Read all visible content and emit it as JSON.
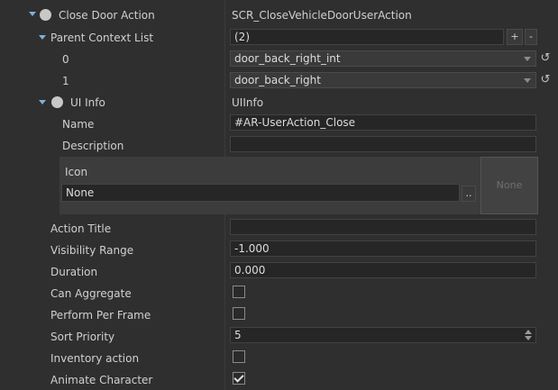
{
  "close_door_action": {
    "label": "Close Door Action",
    "value": "SCR_CloseVehicleDoorUserAction"
  },
  "parent_context_list": {
    "label": "Parent Context List",
    "count": "(2)",
    "add_label": "+",
    "remove_label": "-",
    "items": [
      {
        "index": "0",
        "value": "door_back_right_int"
      },
      {
        "index": "1",
        "value": "door_back_right"
      }
    ]
  },
  "ui_info": {
    "label": "UI Info",
    "value": "UIInfo",
    "name_label": "Name",
    "name_value": "#AR-UserAction_Close",
    "description_label": "Description",
    "description_value": "",
    "icon_label": "Icon",
    "icon_value": "None",
    "icon_browse": "..",
    "icon_preview": "None"
  },
  "properties": {
    "action_title_label": "Action Title",
    "action_title_value": "",
    "visibility_range_label": "Visibility Range",
    "visibility_range_value": "-1.000",
    "duration_label": "Duration",
    "duration_value": "0.000",
    "can_aggregate_label": "Can Aggregate",
    "can_aggregate_checked": false,
    "perform_per_frame_label": "Perform Per Frame",
    "perform_per_frame_checked": false,
    "sort_priority_label": "Sort  Priority",
    "sort_priority_value": "5",
    "inventory_action_label": "Inventory action",
    "inventory_action_checked": false,
    "animate_character_label": "Animate Character",
    "animate_character_checked": true
  },
  "colors": {
    "background": "#2f2f2f",
    "field": "#262626",
    "icon_panel": "#3c3c3c",
    "expander_arrow": "#7fb0da"
  },
  "icons": {
    "expand": "chevron-down-icon",
    "collapsed": "chevron-right-icon",
    "reset": "reset-icon",
    "dropdown": "dropdown-arrow-icon",
    "checkbox": "checkbox-icon"
  }
}
